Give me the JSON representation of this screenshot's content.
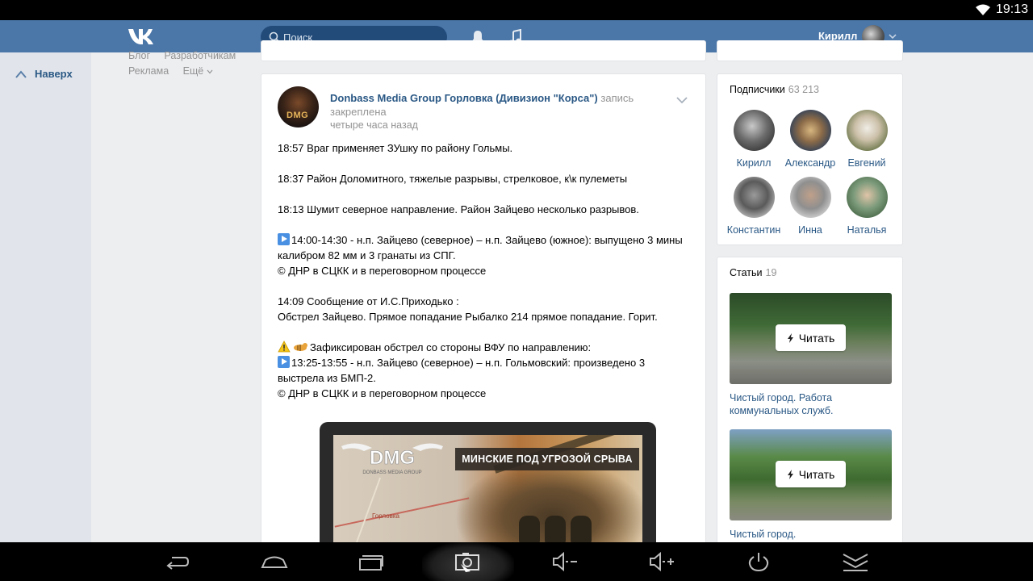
{
  "status_bar": {
    "time": "19:13",
    "wifi_icon": "wifi-icon"
  },
  "header": {
    "search_placeholder": "Поиск",
    "user_name": "Кирилл",
    "brand_color": "#4a76a8"
  },
  "left": {
    "up_label": "Наверх",
    "menu": {
      "blog": "Блог",
      "developers": "Разработчикам",
      "ads": "Реклама",
      "more": "Ещё"
    }
  },
  "post": {
    "author": "Donbass Media Group Горловка (Дивизион \"Корса\")",
    "action": "запись закреплена",
    "time": "четыре часа назад",
    "p1": "18:57 Враг применяет ЗУшку по району Гольмы.",
    "p2": "18:37 Район Доломитного, тяжелые разрывы, стрелковое, к\\к пулеметы",
    "p3": "18:13 Шумит северное направление. Район Зайцево несколько разрывов.",
    "p4a": "14:00-14:30 - н.п. Зайцево (северное) – н.п. Зайцево (южное): выпущено 3 мины калибром 82 мм и 3 гранаты из СПГ.",
    "p4b": "© ДНР в СЦКК и в переговорном процессе",
    "p5a": "14:09 Сообщение от И.С.Приходько :",
    "p5b": "Обстрел Зайцево. Прямое попадание Рыбалко 214 прямое попадание. Горит.",
    "p6a": "Зафиксирован обстрел со стороны ВФУ по направлению:",
    "p6b": "13:25-13:55 - н.п. Зайцево (северное) – н.п. Гольмовский: произведено 3 выстрела из БМП-2.",
    "p6c": "© ДНР в СЦКК и в переговорном процессе",
    "image_banner": "МИНСКИЕ ПОД УГРОЗОЙ СРЫВА",
    "image_logo": "DMG",
    "image_logo_sub": "DONBASS MEDIA GROUP",
    "image_city": "Горловка",
    "avatar_logo": "DMG"
  },
  "subscribers": {
    "title": "Подписчики",
    "count": "63 213",
    "people": [
      {
        "name": "Кирилл"
      },
      {
        "name": "Александр"
      },
      {
        "name": "Евгений"
      },
      {
        "name": "Константин"
      },
      {
        "name": "Инна"
      },
      {
        "name": "Наталья"
      }
    ]
  },
  "articles": {
    "title": "Статьи",
    "count": "19",
    "read_label": "Читать",
    "items": [
      {
        "title": "Чистый город. Работа коммунальных служб."
      },
      {
        "title": "Чистый город."
      }
    ]
  },
  "nav_bar": {
    "icons": [
      "back-icon",
      "home-icon",
      "recents-icon",
      "screenshot-icon",
      "volume-down-icon",
      "volume-up-icon",
      "power-icon",
      "collapse-icon"
    ]
  }
}
